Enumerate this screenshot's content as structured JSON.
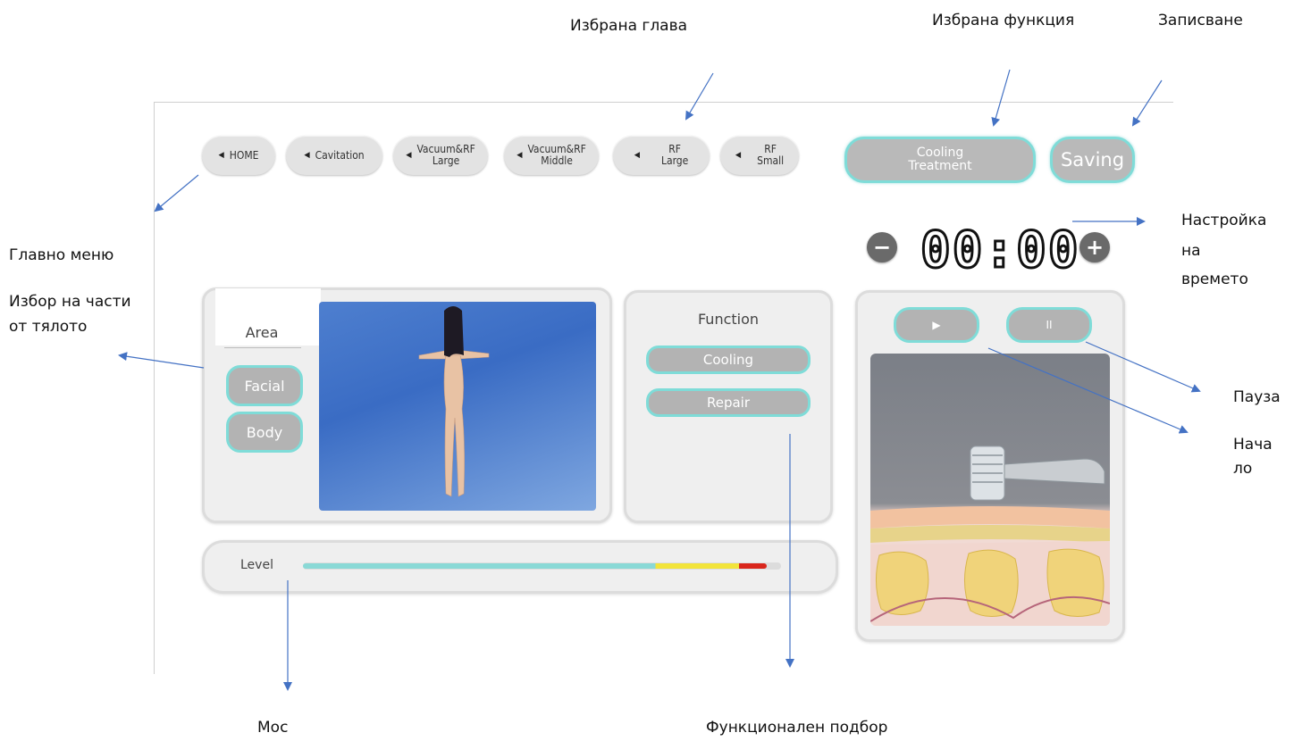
{
  "annotations": {
    "selected_head": "Избрана глава",
    "selected_function": "Избрана функция",
    "saving": "Записване",
    "main_menu": "Главно меню",
    "body_parts_line1": "Избор на части",
    "body_parts_line2": "от тялото",
    "time_setting_line1": "Настройка",
    "time_setting_line2": "на",
    "time_setting_line3": "времето",
    "pause": "Пауза",
    "start_line1": "Нача",
    "start_line2": "ло",
    "power": "Мос",
    "function_selection": "Функционален подбор"
  },
  "chapter_tabs": [
    {
      "label": "HOME"
    },
    {
      "label": "Cavitation"
    },
    {
      "label": "Vacuum&RF\nLarge"
    },
    {
      "label": "Vacuum&RF\nMiddle"
    },
    {
      "label": "RF\nLarge"
    },
    {
      "label": "RF\nSmall"
    }
  ],
  "selected_function_button": "Cooling\nTreatment",
  "saving_button": "Saving",
  "timer": {
    "value": "00:00",
    "minus": "−",
    "plus": "+"
  },
  "area_panel": {
    "title": "Area",
    "buttons": [
      "Facial",
      "Body"
    ]
  },
  "function_panel": {
    "title": "Function",
    "buttons": [
      "Cooling",
      "Repair"
    ]
  },
  "level": {
    "label": "Level",
    "fill_fraction": 0.97
  },
  "controls": {
    "play_icon": "▶",
    "pause_icon": "II"
  },
  "colors": {
    "accent": "#7fdcd8",
    "button_gray": "#b3b3b3",
    "arrow": "#4472c4",
    "level_cyan": "#8ad9d6",
    "level_yellow": "#f2e43a",
    "level_red": "#d9261c"
  }
}
